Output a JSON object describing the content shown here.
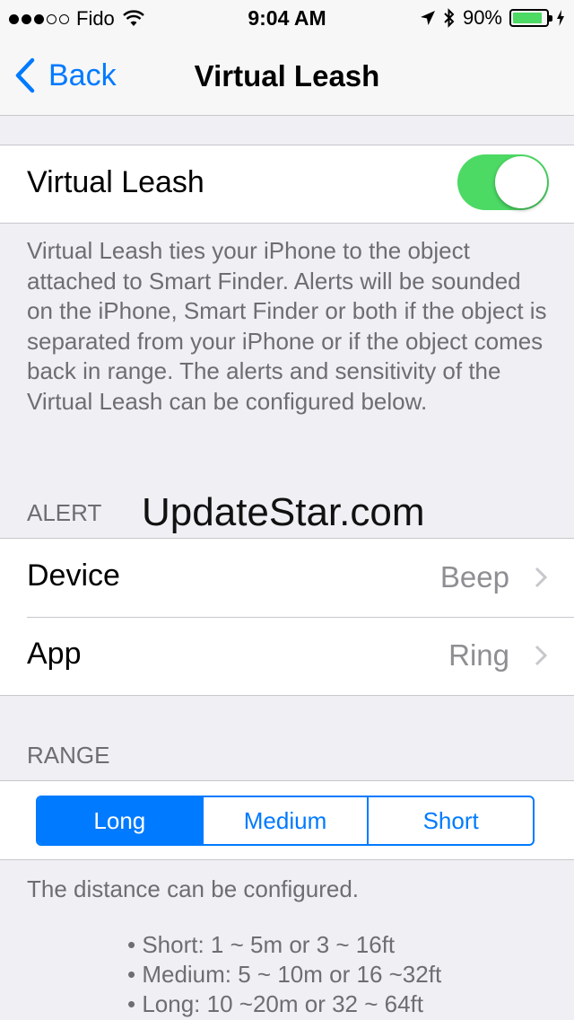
{
  "status": {
    "carrier": "Fido",
    "time": "9:04 AM",
    "battery": "90%",
    "battery_level": 0.9
  },
  "nav": {
    "back_label": "Back",
    "title": "Virtual Leash"
  },
  "toggle_row": {
    "label": "Virtual Leash",
    "on": true
  },
  "description": "Virtual Leash ties your iPhone to the object attached to Smart Finder. Alerts will be sounded on the iPhone, Smart Finder or both if the object is separated from your iPhone or  if the object comes back in range.  The alerts and sensitivity of the Virtual Leash can be configured below.",
  "alert_section": {
    "header": "ALERT",
    "rows": [
      {
        "label": "Device",
        "value": "Beep"
      },
      {
        "label": "App",
        "value": "Ring"
      }
    ]
  },
  "watermark": "UpdateStar.com",
  "range_section": {
    "header": "RANGE",
    "segments": [
      "Long",
      "Medium",
      "Short"
    ],
    "selected": "Long",
    "footer": "The distance can be configured.",
    "bullets": [
      "• Short: 1 ~ 5m or 3 ~ 16ft",
      "• Medium: 5 ~ 10m or 16 ~32ft",
      "• Long: 10 ~20m or 32 ~ 64ft"
    ]
  },
  "colors": {
    "accent": "#007aff",
    "toggle_on": "#4cd964",
    "secondary_text": "#6d6d72",
    "background": "#efeff4"
  }
}
